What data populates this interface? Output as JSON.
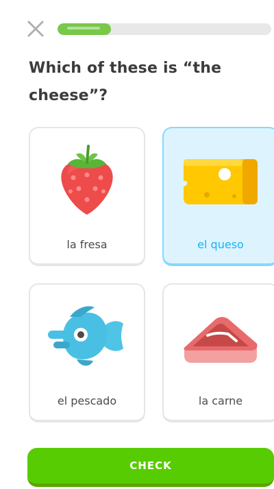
{
  "header": {
    "close_icon": "close-icon",
    "progress_fraction": 0.25,
    "progress_color": "#78c84a"
  },
  "question": {
    "text": "Which of these is “the cheese”?"
  },
  "options": [
    {
      "label": "la fresa",
      "icon": "strawberry-icon",
      "selected": false
    },
    {
      "label": "el queso",
      "icon": "cheese-icon",
      "selected": true
    },
    {
      "label": "el pescado",
      "icon": "fish-icon",
      "selected": false
    },
    {
      "label": "la carne",
      "icon": "meat-icon",
      "selected": false
    }
  ],
  "footer": {
    "check_label": "CHECK",
    "check_color": "#58cc02"
  },
  "colors": {
    "selected_background": "#ddf4ff",
    "selected_border": "#84d8ff",
    "selected_text": "#1cb0f6"
  }
}
